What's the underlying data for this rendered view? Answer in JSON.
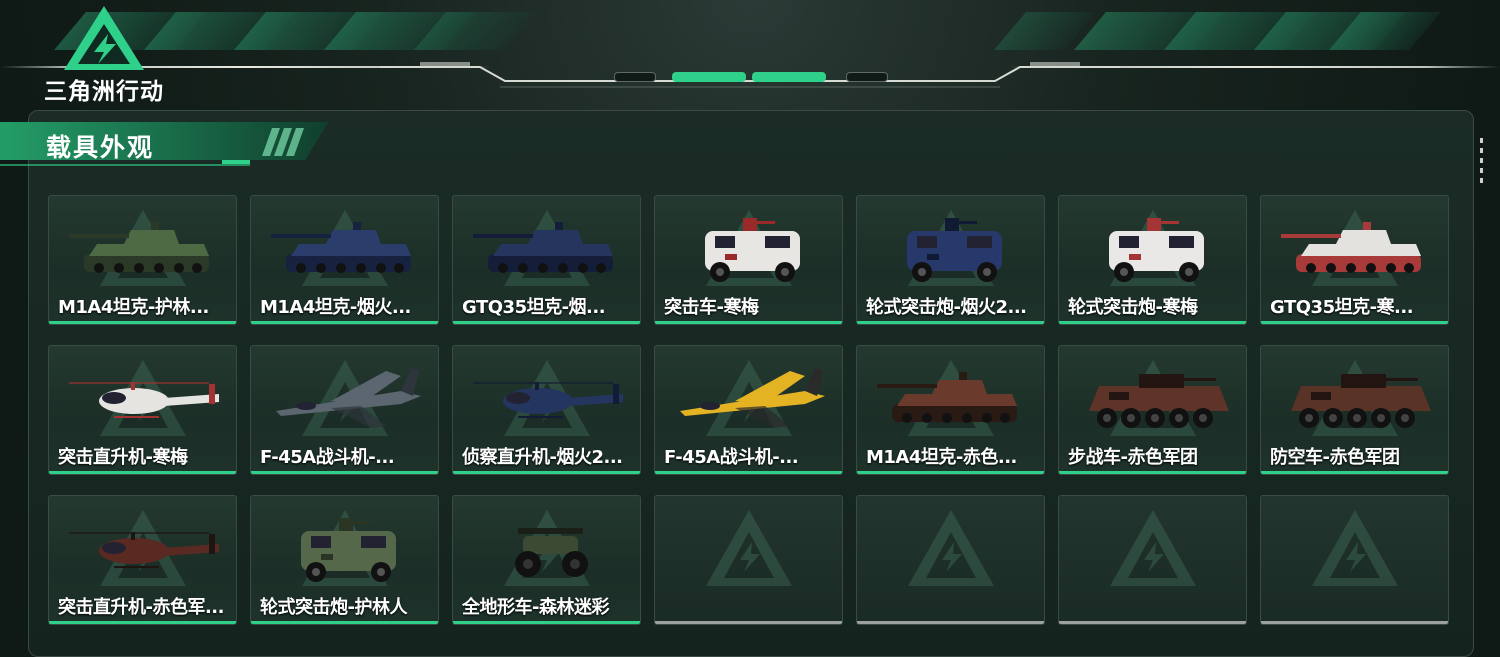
{
  "app": {
    "logo_text": "三角洲行动"
  },
  "panel": {
    "title": "载具外观"
  },
  "items": [
    {
      "label": "M1A4坦克-护林...",
      "kind": "tank",
      "color": "#4d6a45",
      "accent": "#2b3a26"
    },
    {
      "label": "M1A4坦克-烟火...",
      "kind": "tank",
      "color": "#2a3d6b",
      "accent": "#16223f"
    },
    {
      "label": "GTQ35坦克-烟...",
      "kind": "tank",
      "color": "#25355e",
      "accent": "#141e38"
    },
    {
      "label": "突击车-寒梅",
      "kind": "truck",
      "color": "#e8e6e3",
      "accent": "#9a2a2a"
    },
    {
      "label": "轮式突击炮-烟火2...",
      "kind": "truck",
      "color": "#27396a",
      "accent": "#111a33"
    },
    {
      "label": "轮式突击炮-寒梅",
      "kind": "truck",
      "color": "#e9e8e6",
      "accent": "#a53535"
    },
    {
      "label": "GTQ35坦克-寒...",
      "kind": "tank",
      "color": "#e4e2df",
      "accent": "#a83a3a"
    },
    {
      "label": "突击直升机-寒梅",
      "kind": "heli",
      "color": "#e6e4e1",
      "accent": "#a33232"
    },
    {
      "label": "F-45A战斗机-...",
      "kind": "jet",
      "color": "#5c6670",
      "accent": "#2e353c"
    },
    {
      "label": "侦察直升机-烟火2...",
      "kind": "heli",
      "color": "#24365f",
      "accent": "#121c36"
    },
    {
      "label": "F-45A战斗机-...",
      "kind": "jet",
      "color": "#e3b324",
      "accent": "#2a2a2a"
    },
    {
      "label": "M1A4坦克-赤色...",
      "kind": "tank",
      "color": "#6a3a2c",
      "accent": "#2a1a14"
    },
    {
      "label": "步战车-赤色军团",
      "kind": "ifv",
      "color": "#5e3428",
      "accent": "#231511"
    },
    {
      "label": "防空车-赤色军团",
      "kind": "ifv",
      "color": "#5a3327",
      "accent": "#221410"
    },
    {
      "label": "突击直升机-赤色军...",
      "kind": "heli",
      "color": "#5a2a22",
      "accent": "#1e1410"
    },
    {
      "label": "轮式突击炮-护林人",
      "kind": "truck",
      "color": "#55694a",
      "accent": "#2a3524"
    },
    {
      "label": "全地形车-森林迷彩",
      "kind": "atv",
      "color": "#3c4a34",
      "accent": "#1a1f18"
    },
    {
      "label": "",
      "kind": "empty"
    },
    {
      "label": "",
      "kind": "empty"
    },
    {
      "label": "",
      "kind": "empty"
    },
    {
      "label": "",
      "kind": "empty"
    }
  ],
  "colors": {
    "accent_green": "#2fd08a",
    "empty_bar": "#9aa19e"
  }
}
